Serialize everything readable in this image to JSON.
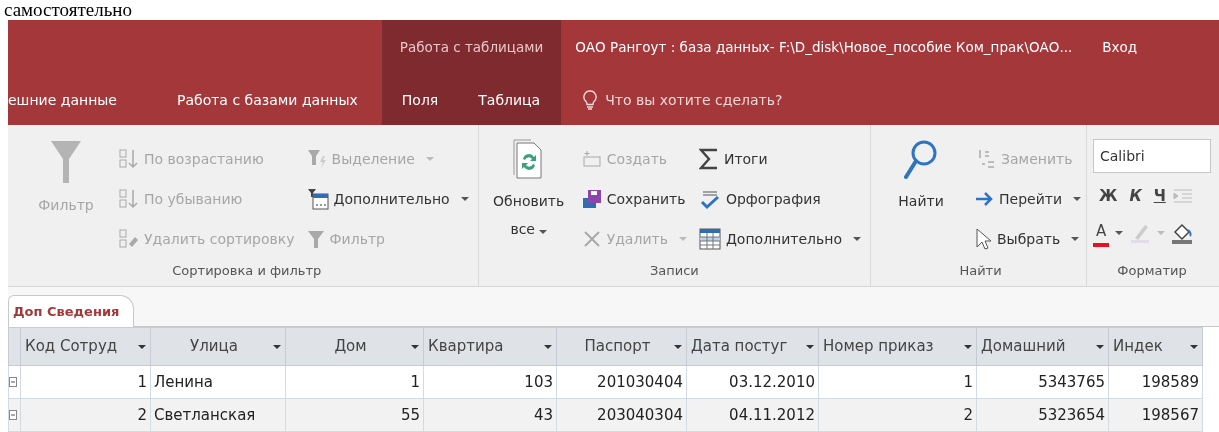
{
  "document_text": "самостоятельно",
  "title_bar": {
    "contextual_group": "Работа с таблицами",
    "title": "ОАО Рангоут : база данных- F:\\D_disk\\Новое_пособие Ком_прак\\ОАО...",
    "account": "Вход"
  },
  "tabs": [
    {
      "label": "ешние данные",
      "contextual": false
    },
    {
      "label": "Работа с базами данных",
      "contextual": false
    },
    {
      "label": "Поля",
      "contextual": true
    },
    {
      "label": "Таблица",
      "contextual": true
    }
  ],
  "tell_me": "Что вы хотите сделать?",
  "ribbon_groups": [
    {
      "label": "Сортировка и фильтр",
      "columns": [
        [
          {
            "kind": "large",
            "label": "Фильтр",
            "disabled": true,
            "dropdown": false
          }
        ],
        [
          {
            "kind": "small",
            "label": "По возрастанию",
            "disabled": true,
            "dropdown": false
          },
          {
            "kind": "small",
            "label": "По убыванию",
            "disabled": true,
            "dropdown": false
          },
          {
            "kind": "small",
            "label": "Удалить сортировку",
            "disabled": true,
            "dropdown": false
          }
        ],
        [
          {
            "kind": "small",
            "label": "Выделение",
            "disabled": true,
            "dropdown": true
          },
          {
            "kind": "small",
            "label": "Дополнительно",
            "disabled": false,
            "dropdown": true
          },
          {
            "kind": "small",
            "label": "Фильтр",
            "disabled": true,
            "dropdown": false
          }
        ]
      ]
    },
    {
      "label": "Записи",
      "columns": [
        [
          {
            "kind": "large",
            "label": "Обновить все",
            "disabled": false,
            "dropdown": true
          }
        ],
        [
          {
            "kind": "small",
            "label": "Создать",
            "disabled": true,
            "dropdown": false
          },
          {
            "kind": "small",
            "label": "Сохранить",
            "disabled": false,
            "dropdown": false
          },
          {
            "kind": "small",
            "label": "Удалить",
            "disabled": true,
            "dropdown": true
          }
        ],
        [
          {
            "kind": "small",
            "label": "Итоги",
            "disabled": false,
            "dropdown": false
          },
          {
            "kind": "small",
            "label": "Орфография",
            "disabled": false,
            "dropdown": false
          },
          {
            "kind": "small",
            "label": "Дополнительно",
            "disabled": false,
            "dropdown": true
          }
        ]
      ]
    },
    {
      "label": "Найти",
      "columns": [
        [
          {
            "kind": "large",
            "label": "Найти",
            "disabled": false,
            "dropdown": false
          }
        ],
        [
          {
            "kind": "small",
            "label": "Заменить",
            "disabled": true,
            "dropdown": false
          },
          {
            "kind": "small",
            "label": "Перейти",
            "disabled": false,
            "dropdown": true
          },
          {
            "kind": "small",
            "label": "Выбрать",
            "disabled": false,
            "dropdown": true
          }
        ]
      ]
    }
  ],
  "format_group": {
    "label": "Форматир",
    "font": "Calibri",
    "style_buttons": [
      {
        "label": "Ж",
        "kind": "bold"
      },
      {
        "label": "К",
        "kind": "italic"
      },
      {
        "label": "Ч",
        "kind": "underline"
      }
    ],
    "font_color": {
      "label": "А",
      "color": "#e81123"
    }
  },
  "document_tabs": [
    {
      "label": "Доп Сведения",
      "selected": true
    }
  ],
  "table": {
    "columns": [
      {
        "label": "Код Сотруд"
      },
      {
        "label": "Улица"
      },
      {
        "label": "Дом"
      },
      {
        "label": "Квартира"
      },
      {
        "label": "Паспорт"
      },
      {
        "label": "Дата постуг"
      },
      {
        "label": "Номер приказ"
      },
      {
        "label": "Домашний"
      },
      {
        "label": "Индек"
      }
    ],
    "rows": [
      {
        "cells": [
          "1",
          "Ленина",
          "1",
          "103",
          "201030404",
          "03.12.2010",
          "1",
          "5343765",
          "198589"
        ]
      },
      {
        "cells": [
          "2",
          "Светланская",
          "55",
          "43",
          "203040304",
          "04.11.2012",
          "2",
          "5323654",
          "198567"
        ]
      }
    ]
  }
}
